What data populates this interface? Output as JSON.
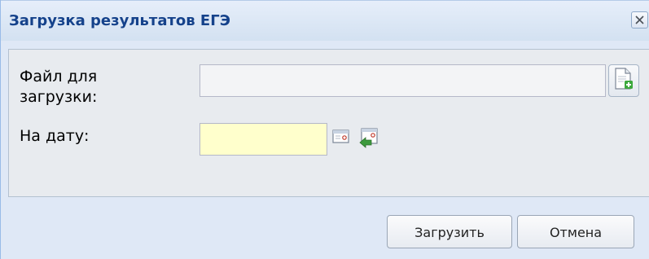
{
  "dialog": {
    "title": "Загрузка результатов ЕГЭ",
    "close_icon": "close-icon"
  },
  "form": {
    "file_label": "Файл для загрузки:",
    "file_value": "",
    "add_file_icon": "document-add-icon",
    "date_label": "На дату:",
    "date_value": "",
    "calendar_icon": "calendar-icon",
    "clear_date_icon": "clear-date-icon"
  },
  "buttons": {
    "upload_label": "Загрузить",
    "cancel_label": "Отмена"
  },
  "colors": {
    "title_text": "#15428b",
    "date_field_bg": "#ffffcc",
    "panel_bg": "#e8ebef",
    "frame_bg": "#dfe8f6"
  }
}
